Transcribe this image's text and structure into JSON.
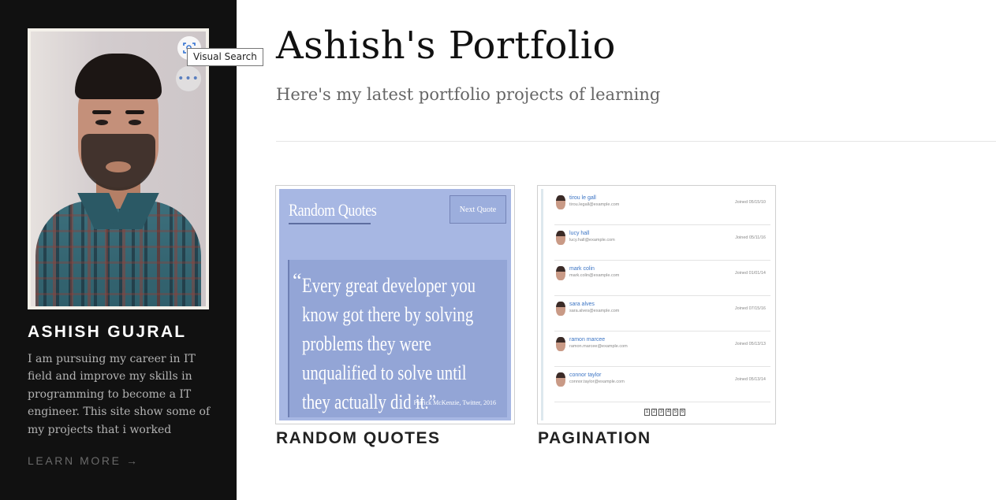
{
  "sidebar": {
    "name": "ASHISH GUJRAL",
    "bio": "I am pursuing my career in IT field and improve my skills in programming to become a IT engineer. This site show some of my projects that i worked",
    "learn_more": "LEARN MORE →",
    "photo_tooltip": "Visual Search",
    "more_icon": "•••"
  },
  "header": {
    "title": "Ashish's Portfolio",
    "subtitle": "Here's my latest portfolio projects of learning"
  },
  "projects": [
    {
      "title": "RANDOM QUOTES",
      "thumbnail": {
        "heading": "Random Quotes",
        "button": "Next Quote",
        "quote_mark": "“",
        "quote": "Every great developer you know got there by solving problems they were unqualified to solve until they actually did it.”",
        "author": "Patrick McKenzie, Twitter, 2016"
      }
    },
    {
      "title": "PAGINATION",
      "thumbnail": {
        "users": [
          {
            "name": "tirou le gall",
            "email": "tirou.legall@example.com",
            "joined": "Joined 05/15/10"
          },
          {
            "name": "lucy hall",
            "email": "lucy.hall@example.com",
            "joined": "Joined 05/11/16"
          },
          {
            "name": "mark colin",
            "email": "mark.colin@example.com",
            "joined": "Joined 01/01/14"
          },
          {
            "name": "sara alves",
            "email": "sara.alves@example.com",
            "joined": "Joined 07/15/16"
          },
          {
            "name": "ramon marcee",
            "email": "ramon.marcee@example.com",
            "joined": "Joined 05/13/13"
          },
          {
            "name": "connor taylor",
            "email": "connor.taylor@example.com",
            "joined": "Joined 05/13/14"
          }
        ],
        "pages": [
          "1",
          "2",
          "3",
          "4",
          "5",
          "6"
        ]
      }
    }
  ]
}
